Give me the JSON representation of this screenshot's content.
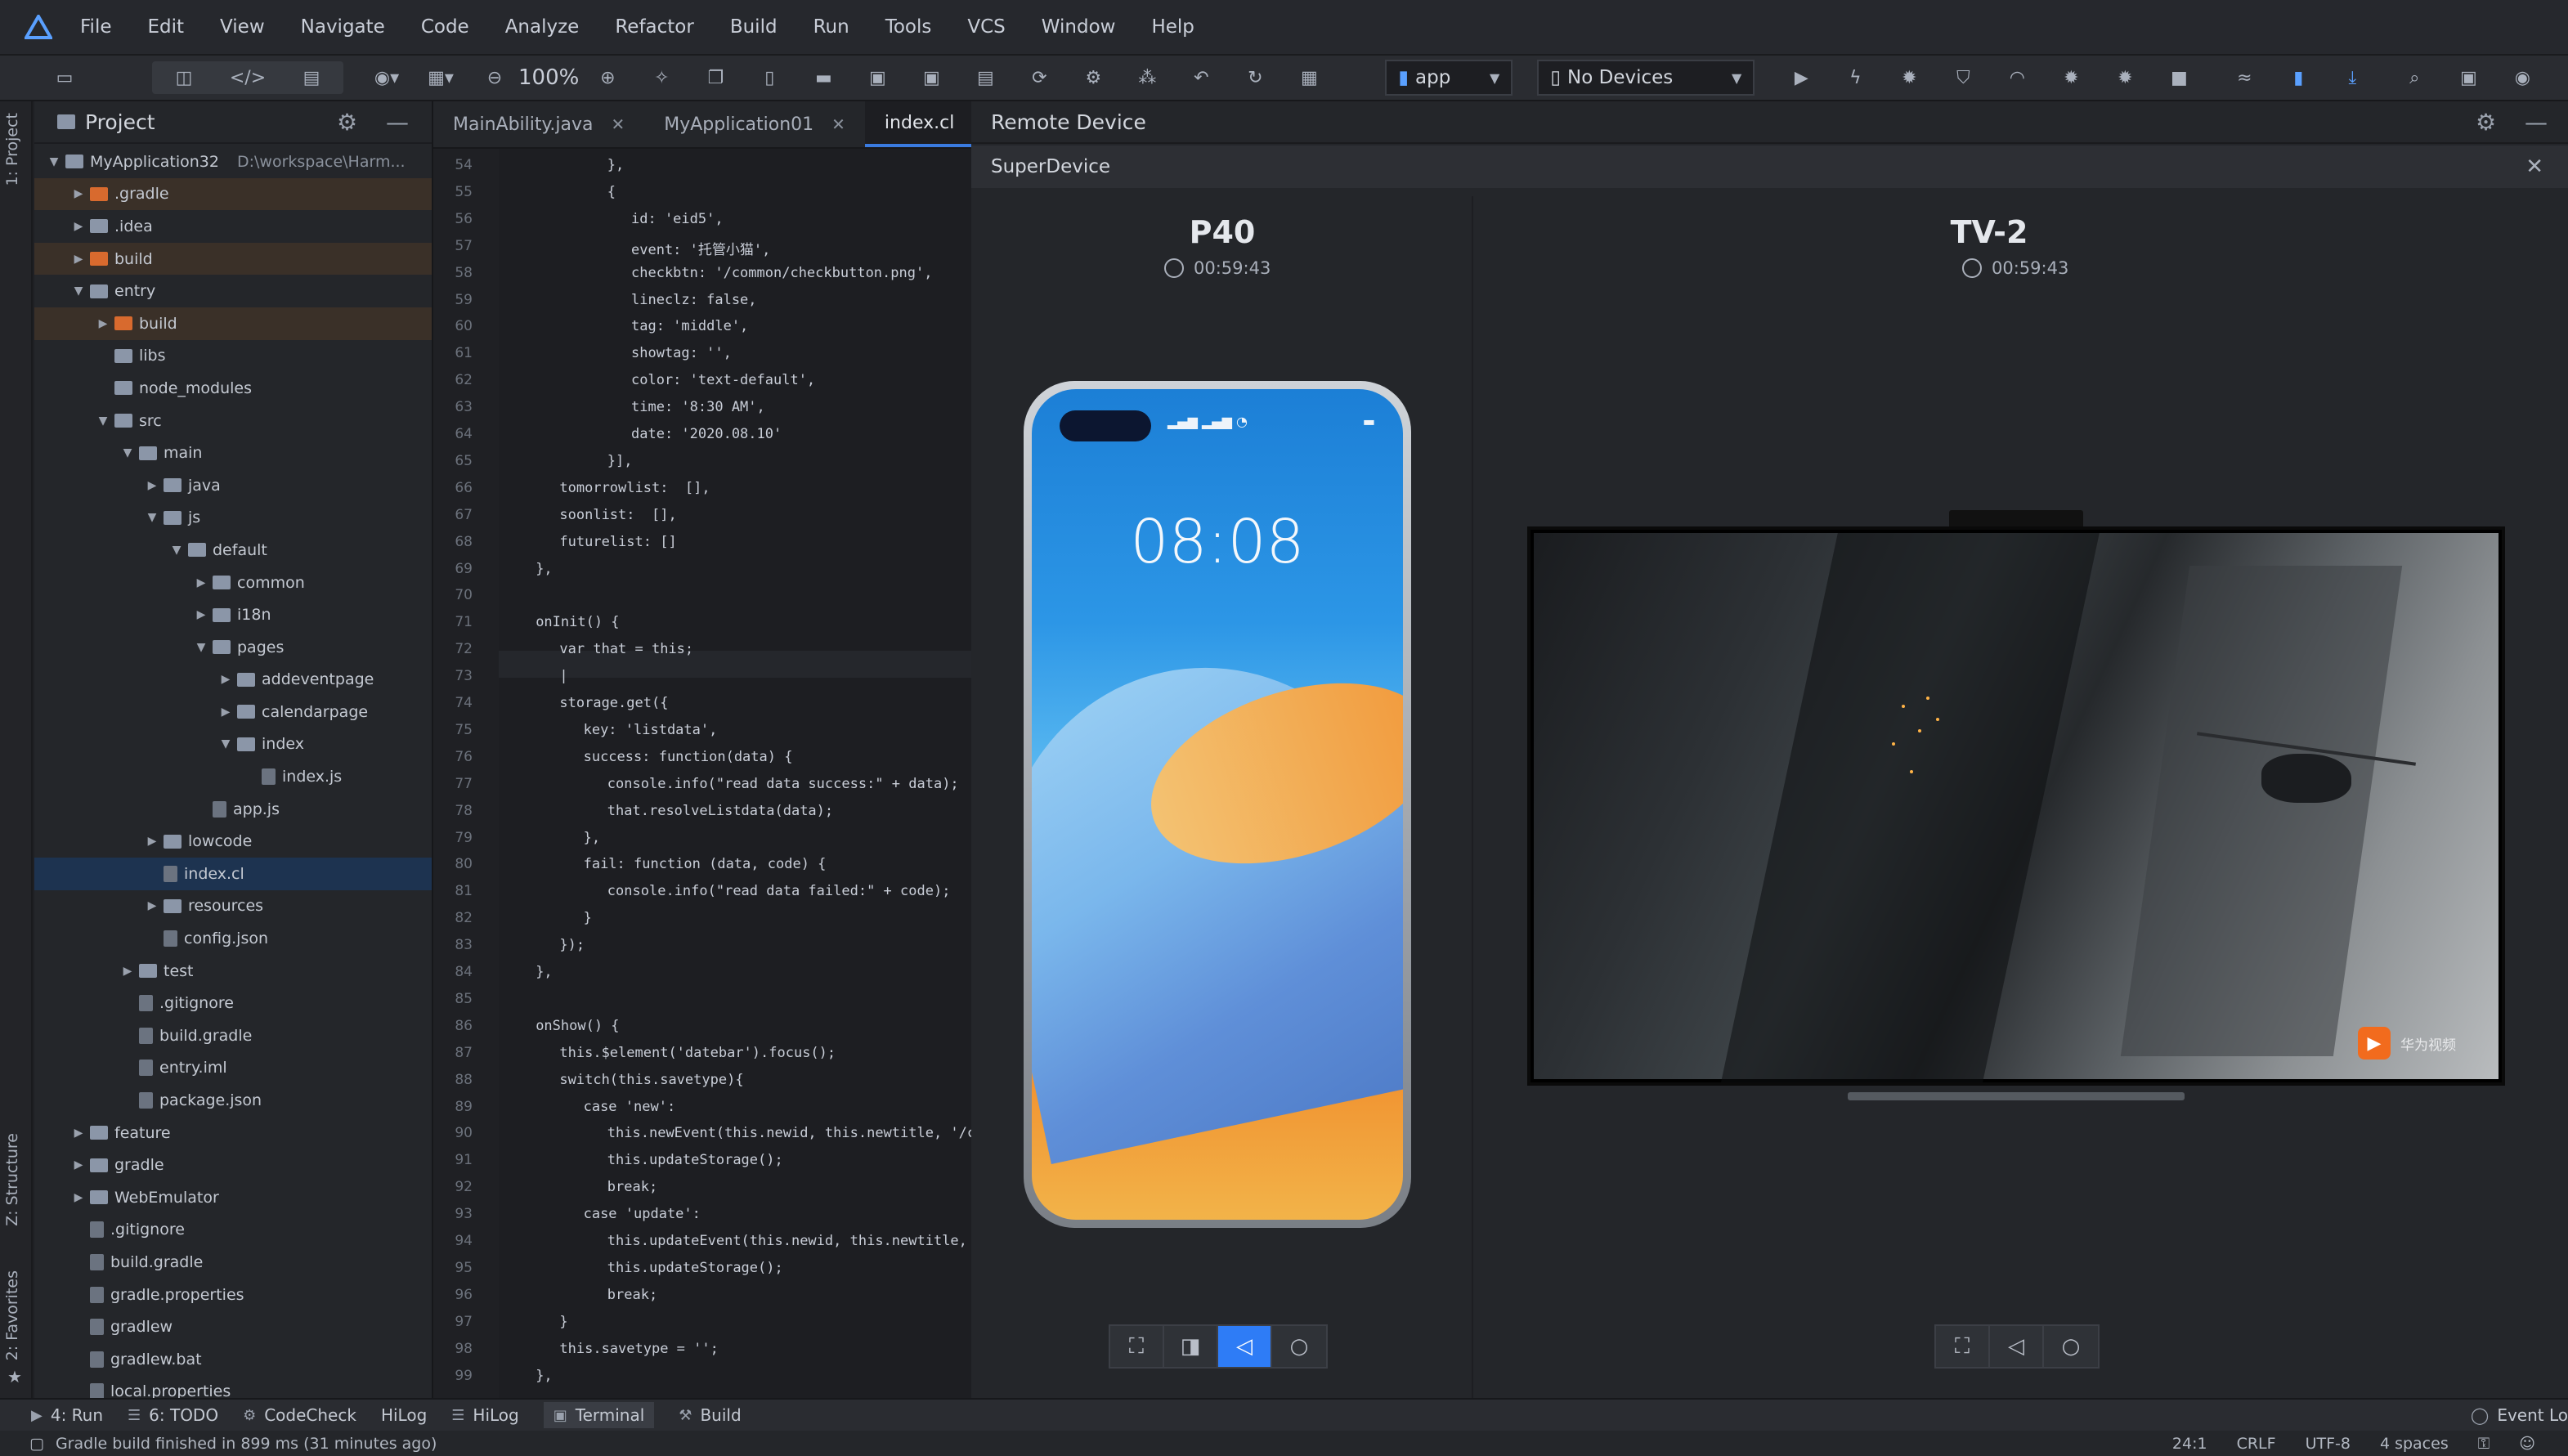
{
  "menu": [
    "File",
    "Edit",
    "View",
    "Navigate",
    "Code",
    "Analyze",
    "Refactor",
    "Build",
    "Run",
    "Tools",
    "VCS",
    "Window",
    "Help"
  ],
  "toolbar": {
    "zoom": "100%",
    "module_combo": "app",
    "device_combo": "No Devices"
  },
  "left_strip": {
    "project_label": "1: Project",
    "structure_label": "Z: Structure",
    "favorites_label": "2: Favorites"
  },
  "project": {
    "title": "Project",
    "tree": [
      {
        "label": "MyApplication32",
        "path": "D:\\workspace\\Harm...",
        "depth": 0,
        "caret": "open",
        "icon": "f",
        "style": ""
      },
      {
        "label": ".gradle",
        "depth": 1,
        "caret": "closed",
        "icon": "fo",
        "style": "excl"
      },
      {
        "label": ".idea",
        "depth": 1,
        "caret": "closed",
        "icon": "f",
        "style": ""
      },
      {
        "label": "build",
        "depth": 1,
        "caret": "closed",
        "icon": "fo",
        "style": "excl"
      },
      {
        "label": "entry",
        "depth": 1,
        "caret": "open",
        "icon": "f",
        "style": ""
      },
      {
        "label": "build",
        "depth": 2,
        "caret": "closed",
        "icon": "fo",
        "style": "excl"
      },
      {
        "label": "libs",
        "depth": 2,
        "caret": "",
        "icon": "f",
        "style": ""
      },
      {
        "label": "node_modules",
        "depth": 2,
        "caret": "",
        "icon": "f",
        "style": ""
      },
      {
        "label": "src",
        "depth": 2,
        "caret": "open",
        "icon": "f",
        "style": ""
      },
      {
        "label": "main",
        "depth": 3,
        "caret": "open",
        "icon": "f",
        "style": ""
      },
      {
        "label": "java",
        "depth": 4,
        "caret": "closed",
        "icon": "f",
        "style": ""
      },
      {
        "label": "js",
        "depth": 4,
        "caret": "open",
        "icon": "f",
        "style": ""
      },
      {
        "label": "default",
        "depth": 5,
        "caret": "open",
        "icon": "f",
        "style": ""
      },
      {
        "label": "common",
        "depth": 6,
        "caret": "closed",
        "icon": "f",
        "style": ""
      },
      {
        "label": "i18n",
        "depth": 6,
        "caret": "closed",
        "icon": "f",
        "style": ""
      },
      {
        "label": "pages",
        "depth": 6,
        "caret": "open",
        "icon": "f",
        "style": ""
      },
      {
        "label": "addeventpage",
        "depth": 7,
        "caret": "closed",
        "icon": "f",
        "style": ""
      },
      {
        "label": "calendarpage",
        "depth": 7,
        "caret": "closed",
        "icon": "f",
        "style": ""
      },
      {
        "label": "index",
        "depth": 7,
        "caret": "open",
        "icon": "f",
        "style": ""
      },
      {
        "label": "index.js",
        "depth": 8,
        "caret": "",
        "icon": "fi",
        "style": ""
      },
      {
        "label": "app.js",
        "depth": 6,
        "caret": "",
        "icon": "fi",
        "style": ""
      },
      {
        "label": "lowcode",
        "depth": 4,
        "caret": "closed",
        "icon": "f",
        "style": ""
      },
      {
        "label": "index.cl",
        "depth": 4,
        "caret": "",
        "icon": "fi",
        "style": "sel"
      },
      {
        "label": "resources",
        "depth": 4,
        "caret": "closed",
        "icon": "f",
        "style": ""
      },
      {
        "label": "config.json",
        "depth": 4,
        "caret": "",
        "icon": "fi",
        "style": ""
      },
      {
        "label": "test",
        "depth": 3,
        "caret": "closed",
        "icon": "f",
        "style": ""
      },
      {
        "label": ".gitignore",
        "depth": 3,
        "caret": "",
        "icon": "fi",
        "style": ""
      },
      {
        "label": "build.gradle",
        "depth": 3,
        "caret": "",
        "icon": "fi",
        "style": ""
      },
      {
        "label": "entry.iml",
        "depth": 3,
        "caret": "",
        "icon": "fi",
        "style": ""
      },
      {
        "label": "package.json",
        "depth": 3,
        "caret": "",
        "icon": "fi",
        "style": ""
      },
      {
        "label": "feature",
        "depth": 1,
        "caret": "closed",
        "icon": "f",
        "style": ""
      },
      {
        "label": "gradle",
        "depth": 1,
        "caret": "closed",
        "icon": "f",
        "style": ""
      },
      {
        "label": "WebEmulator",
        "depth": 1,
        "caret": "closed",
        "icon": "f",
        "style": ""
      },
      {
        "label": ".gitignore",
        "depth": 1,
        "caret": "",
        "icon": "fi",
        "style": ""
      },
      {
        "label": "build.gradle",
        "depth": 1,
        "caret": "",
        "icon": "fi",
        "style": ""
      },
      {
        "label": "gradle.properties",
        "depth": 1,
        "caret": "",
        "icon": "fi",
        "style": ""
      },
      {
        "label": "gradlew",
        "depth": 1,
        "caret": "",
        "icon": "fi",
        "style": ""
      },
      {
        "label": "gradlew.bat",
        "depth": 1,
        "caret": "",
        "icon": "fi",
        "style": ""
      },
      {
        "label": "local.properties",
        "depth": 1,
        "caret": "",
        "icon": "fi",
        "style": ""
      }
    ]
  },
  "editor": {
    "tabs": [
      {
        "label": "MainAbility.java",
        "closable": true,
        "active": false
      },
      {
        "label": "MyApplication01",
        "closable": true,
        "active": false
      },
      {
        "label": "index.cl",
        "closable": false,
        "active": true
      }
    ],
    "lines": [
      {
        "n": "54",
        "indent": 8,
        "text": "},"
      },
      {
        "n": "55",
        "indent": 8,
        "text": "{"
      },
      {
        "n": "56",
        "indent": 10,
        "text": "id: 'eid5',"
      },
      {
        "n": "57",
        "indent": 10,
        "text": "event: '托管小猫',"
      },
      {
        "n": "58",
        "indent": 10,
        "text": "checkbtn: '/common/checkbutton.png',"
      },
      {
        "n": "59",
        "indent": 10,
        "text": "lineclz: false,"
      },
      {
        "n": "60",
        "indent": 10,
        "text": "tag: 'middle',"
      },
      {
        "n": "61",
        "indent": 10,
        "text": "showtag: '',"
      },
      {
        "n": "62",
        "indent": 10,
        "text": "color: 'text-default',"
      },
      {
        "n": "63",
        "indent": 10,
        "text": "time: '8:30 AM',"
      },
      {
        "n": "64",
        "indent": 10,
        "text": "date: '2020.08.10'"
      },
      {
        "n": "65",
        "indent": 8,
        "text": "}],"
      },
      {
        "n": "66",
        "indent": 4,
        "text": "tomorrowlist:  [],"
      },
      {
        "n": "67",
        "indent": 4,
        "text": "soonlist:  [],"
      },
      {
        "n": "68",
        "indent": 4,
        "text": "futurelist: []"
      },
      {
        "n": "69",
        "indent": 2,
        "text": "},"
      },
      {
        "n": "70",
        "indent": 0,
        "text": ""
      },
      {
        "n": "71",
        "indent": 2,
        "text": "onInit() {"
      },
      {
        "n": "72",
        "indent": 4,
        "text": "var that = this;"
      },
      {
        "n": "73",
        "indent": 4,
        "text": "|"
      },
      {
        "n": "74",
        "indent": 4,
        "text": "storage.get({"
      },
      {
        "n": "75",
        "indent": 6,
        "text": "key: 'listdata',"
      },
      {
        "n": "76",
        "indent": 6,
        "text": "success: function(data) {"
      },
      {
        "n": "77",
        "indent": 8,
        "text": "console.info(\"read data success:\" + data);"
      },
      {
        "n": "78",
        "indent": 8,
        "text": "that.resolveListdata(data);"
      },
      {
        "n": "79",
        "indent": 6,
        "text": "},"
      },
      {
        "n": "80",
        "indent": 6,
        "text": "fail: function (data, code) {"
      },
      {
        "n": "81",
        "indent": 8,
        "text": "console.info(\"read data failed:\" + code);"
      },
      {
        "n": "82",
        "indent": 6,
        "text": "}"
      },
      {
        "n": "83",
        "indent": 4,
        "text": "});"
      },
      {
        "n": "84",
        "indent": 2,
        "text": "},"
      },
      {
        "n": "85",
        "indent": 0,
        "text": ""
      },
      {
        "n": "86",
        "indent": 2,
        "text": "onShow() {"
      },
      {
        "n": "87",
        "indent": 4,
        "text": "this.$element('datebar').focus();"
      },
      {
        "n": "88",
        "indent": 4,
        "text": "switch(this.savetype){"
      },
      {
        "n": "89",
        "indent": 6,
        "text": "case 'new':"
      },
      {
        "n": "90",
        "indent": 8,
        "text": "this.newEvent(this.newid, this.newtitle, '/com"
      },
      {
        "n": "91",
        "indent": 8,
        "text": "this.updateStorage();"
      },
      {
        "n": "92",
        "indent": 8,
        "text": "break;"
      },
      {
        "n": "93",
        "indent": 6,
        "text": "case 'update':"
      },
      {
        "n": "94",
        "indent": 8,
        "text": "this.updateEvent(this.newid, this.newtitle, thi"
      },
      {
        "n": "95",
        "indent": 8,
        "text": "this.updateStorage();"
      },
      {
        "n": "96",
        "indent": 8,
        "text": "break;"
      },
      {
        "n": "97",
        "indent": 4,
        "text": "}"
      },
      {
        "n": "98",
        "indent": 4,
        "text": "this.savetype = '';"
      },
      {
        "n": "99",
        "indent": 2,
        "text": "},"
      }
    ]
  },
  "remote": {
    "title": "Remote Device",
    "super_title": "SuperDevice",
    "phone": {
      "name": "P40",
      "timer": "00:59:43",
      "screen_time": "08:08"
    },
    "tv": {
      "name": "TV-2",
      "timer": "00:59:43",
      "logo_text": "华为视频"
    }
  },
  "bottombar": [
    {
      "icon": "▶",
      "label": "4: Run",
      "active": false
    },
    {
      "icon": "☰",
      "label": "6: TODO",
      "active": false
    },
    {
      "icon": "⚙",
      "label": "CodeCheck",
      "active": false
    },
    {
      "icon": "",
      "label": "HiLog",
      "active": false
    },
    {
      "icon": "☰",
      "label": "HiLog",
      "active": false
    },
    {
      "icon": "▣",
      "label": "Terminal",
      "active": true
    },
    {
      "icon": "⚒",
      "label": "Build",
      "active": false
    }
  ],
  "eventlog": "Event Lo",
  "status": {
    "message": "Gradle build finished in 899 ms (31 minutes ago)",
    "position": "24:1",
    "line_sep": "CRLF",
    "encoding": "UTF-8",
    "indent": "4 spaces"
  },
  "colors": {
    "accent": "#2e7cf6",
    "excluded_folder": "#d86a2e",
    "selection": "#1d3350"
  }
}
